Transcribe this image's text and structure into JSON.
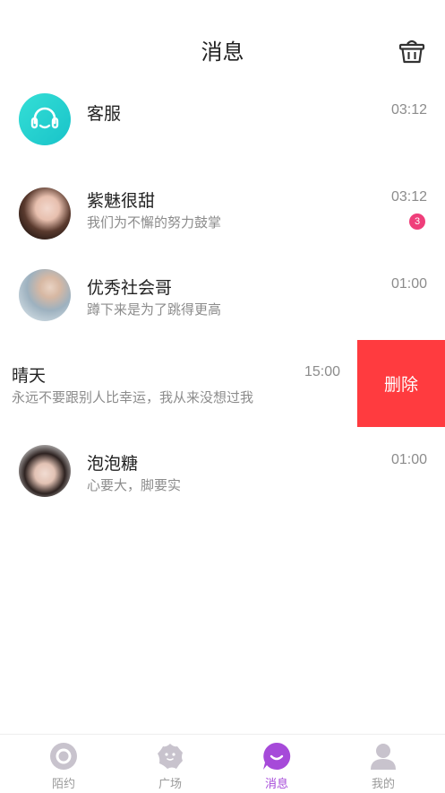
{
  "header": {
    "title": "消息",
    "trash_icon": "trash-basket-icon"
  },
  "conversations": [
    {
      "name": "客服",
      "preview": "",
      "time": "03:12",
      "avatar": "headset-icon"
    },
    {
      "name": "紫魅很甜",
      "preview": "我们为不懈的努力鼓掌",
      "time": "03:12",
      "badge": "3"
    },
    {
      "name": "优秀社会哥",
      "preview": "蹲下来是为了跳得更高",
      "time": "01:00"
    },
    {
      "name": "晴天",
      "preview": "永远不要跟别人比幸运，我从来没想过我",
      "time": "15:00",
      "delete_label": "删除"
    },
    {
      "name": "泡泡糖",
      "preview": "心要大，脚要实",
      "time": "01:00"
    }
  ],
  "tabbar": {
    "tabs": [
      {
        "label": "陌约",
        "icon": "camera-lens-icon"
      },
      {
        "label": "广场",
        "icon": "flower-face-icon"
      },
      {
        "label": "消息",
        "icon": "message-smile-icon",
        "active": true
      },
      {
        "label": "我的",
        "icon": "person-icon"
      }
    ]
  },
  "colors": {
    "accent": "#a64ad9",
    "delete": "#ff3b3f",
    "badge": "#ef3e7a",
    "service": "#1fd0c8"
  }
}
